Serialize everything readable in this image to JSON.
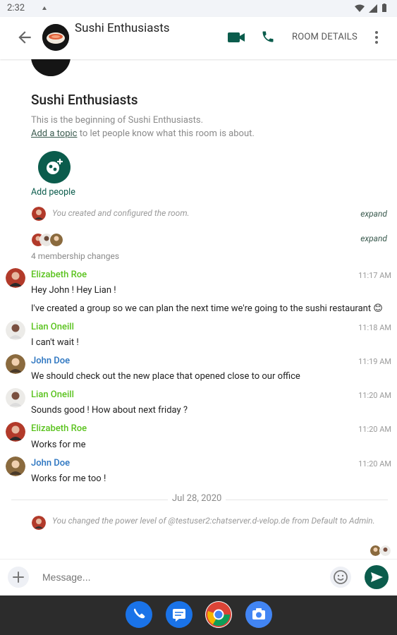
{
  "status_bar": {
    "time": "2:32"
  },
  "app_bar": {
    "title": "Sushi Enthusiasts",
    "room_details": "ROOM DETAILS"
  },
  "room_header": {
    "name": "Sushi Enthusiasts",
    "beginning": "This is the beginning of Sushi Enthusiasts.",
    "topic_link": "Add a topic",
    "topic_rest": " to let people know what this room is about.",
    "add_people": "Add people"
  },
  "events": {
    "created": "You created and configured the room.",
    "expand": "expand",
    "membership": "4 membership changes",
    "power": "You changed the power level of @testuser2:chatserver.d-velop.de from Default to Admin."
  },
  "messages": [
    {
      "sender": "Elizabeth Roe",
      "time": "11:17 AM",
      "lines": [
        "Hey John ! Hey Lian !",
        "I've created a group so we can plan the next time we're going to the sushi restaurant 😊"
      ]
    },
    {
      "sender": "Lian Oneill",
      "time": "11:18 AM",
      "lines": [
        "I can't wait !"
      ]
    },
    {
      "sender": "John Doe",
      "time": "11:19 AM",
      "lines": [
        "We should check out the new place that opened close to our office"
      ]
    },
    {
      "sender": "Lian Oneill",
      "time": "11:20 AM",
      "lines": [
        "Sounds good ! How about next friday ?"
      ]
    },
    {
      "sender": "Elizabeth Roe",
      "time": "11:20 AM",
      "lines": [
        "Works for me"
      ]
    },
    {
      "sender": "John Doe",
      "time": "11:20 AM",
      "lines": [
        "Works for me too !"
      ]
    }
  ],
  "date_separator": "Jul 28, 2020",
  "composer": {
    "placeholder": "Message..."
  },
  "colors": {
    "accent": "#0b5c4c",
    "name_green": "#5bc31f",
    "name_blue": "#2a74c0"
  },
  "dock_apps": [
    "phone-icon",
    "messages-icon",
    "chrome-icon",
    "camera-icon"
  ]
}
